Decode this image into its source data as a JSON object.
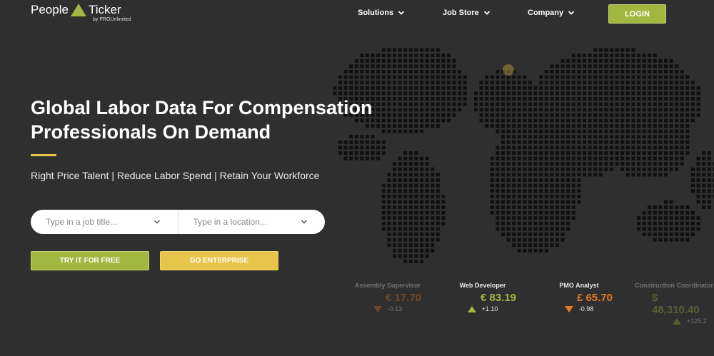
{
  "brand": {
    "name_left": "People",
    "name_right": "Ticker",
    "sub": "by PROUnlimited",
    "accent": "#a2b73f"
  },
  "nav": {
    "items": [
      {
        "label": "Solutions"
      },
      {
        "label": "Job Store"
      },
      {
        "label": "Company"
      }
    ],
    "login_label": "LOGIN"
  },
  "hero": {
    "title_line1": "Global Labor Data For Compensation",
    "title_line2": "Professionals On Demand",
    "subtitle": "Right Price Talent | Reduce Labor Spend | Retain Your Workforce"
  },
  "search": {
    "job_placeholder": "Type in a job title...",
    "location_placeholder": "Type in a location..."
  },
  "cta": {
    "try_label": "TRY IT FOR FREE",
    "enterprise_label": "GO ENTERPRISE"
  },
  "tickers": [
    {
      "title": "Assembly Supervisor",
      "price": "€ 17.70",
      "change": "-0.13",
      "direction": "down",
      "color": "#e07b22"
    },
    {
      "title": "Web Developer",
      "price": "€ 83.19",
      "change": "+1.10",
      "direction": "up",
      "color": "#a2b73f"
    },
    {
      "title": "PMO Analyst",
      "price": "£ 65.70",
      "change": "-0.98",
      "direction": "down",
      "color": "#e07b22"
    },
    {
      "title": "Construction Coordinator",
      "price": "$ 48,310.40",
      "change": "+125.2",
      "direction": "up",
      "color": "#a2b73f"
    }
  ],
  "colors": {
    "background": "#2f2f2f",
    "green": "#a2b73f",
    "yellow": "#e7c54a",
    "orange": "#e07b22",
    "map_dot": "#0f0f0f"
  }
}
